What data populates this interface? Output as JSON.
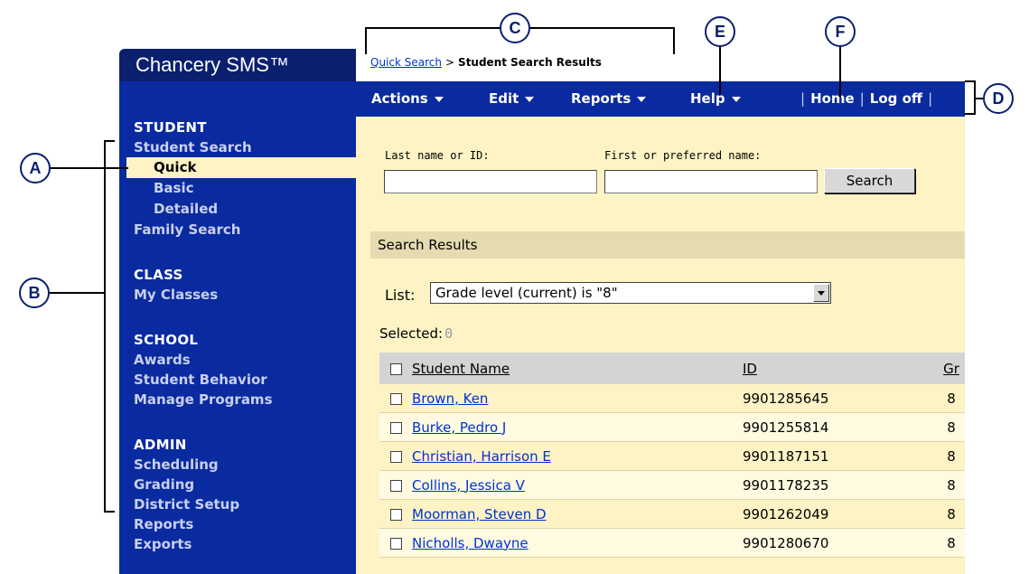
{
  "app": {
    "title": "Chancery SMS™"
  },
  "breadcrumb": {
    "link": "Quick Search",
    "separator": ">",
    "current": "Student Search Results"
  },
  "menubar": {
    "menus": [
      "Actions",
      "Edit",
      "Reports",
      "Help"
    ],
    "home": "Home",
    "logoff": "Log off",
    "divider": "|"
  },
  "sidebar": {
    "student": {
      "heading": "STUDENT",
      "items": [
        "Student Search",
        "Quick",
        "Basic",
        "Detailed",
        "Family Search"
      ]
    },
    "class": {
      "heading": "CLASS",
      "items": [
        "My Classes"
      ]
    },
    "school": {
      "heading": "SCHOOL",
      "items": [
        "Awards",
        "Student Behavior",
        "Manage Programs"
      ]
    },
    "admin": {
      "heading": "ADMIN",
      "items": [
        "Scheduling",
        "Grading",
        "District Setup",
        "Reports",
        "Exports"
      ]
    }
  },
  "search": {
    "last_label": "Last name or ID:",
    "first_label": "First or preferred name:",
    "last_value": "",
    "first_value": "",
    "button": "Search"
  },
  "results": {
    "header": "Search Results",
    "list_label": "List:",
    "list_value": "Grade level (current) is \"8\"",
    "selected_label": "Selected:",
    "selected_count": "0",
    "columns": [
      "Student Name",
      "ID",
      "Gr"
    ],
    "rows": [
      {
        "name": "Brown, Ken",
        "id": "9901285645",
        "gr": "8"
      },
      {
        "name": "Burke, Pedro J",
        "id": "9901255814",
        "gr": "8"
      },
      {
        "name": "Christian, Harrison E",
        "id": "9901187151",
        "gr": "8"
      },
      {
        "name": "Collins, Jessica V",
        "id": "9901178235",
        "gr": "8"
      },
      {
        "name": "Moorman, Steven D",
        "id": "9901262049",
        "gr": "8"
      },
      {
        "name": "Nicholls, Dwayne",
        "id": "9901280670",
        "gr": "8"
      }
    ]
  },
  "callouts": [
    "A",
    "B",
    "C",
    "D",
    "E",
    "F"
  ],
  "colors": {
    "nav_blue": "#0a2aa0",
    "brand_navy": "#0a1f6e",
    "content_bg": "#fdf3c5",
    "link": "#0033cc"
  }
}
